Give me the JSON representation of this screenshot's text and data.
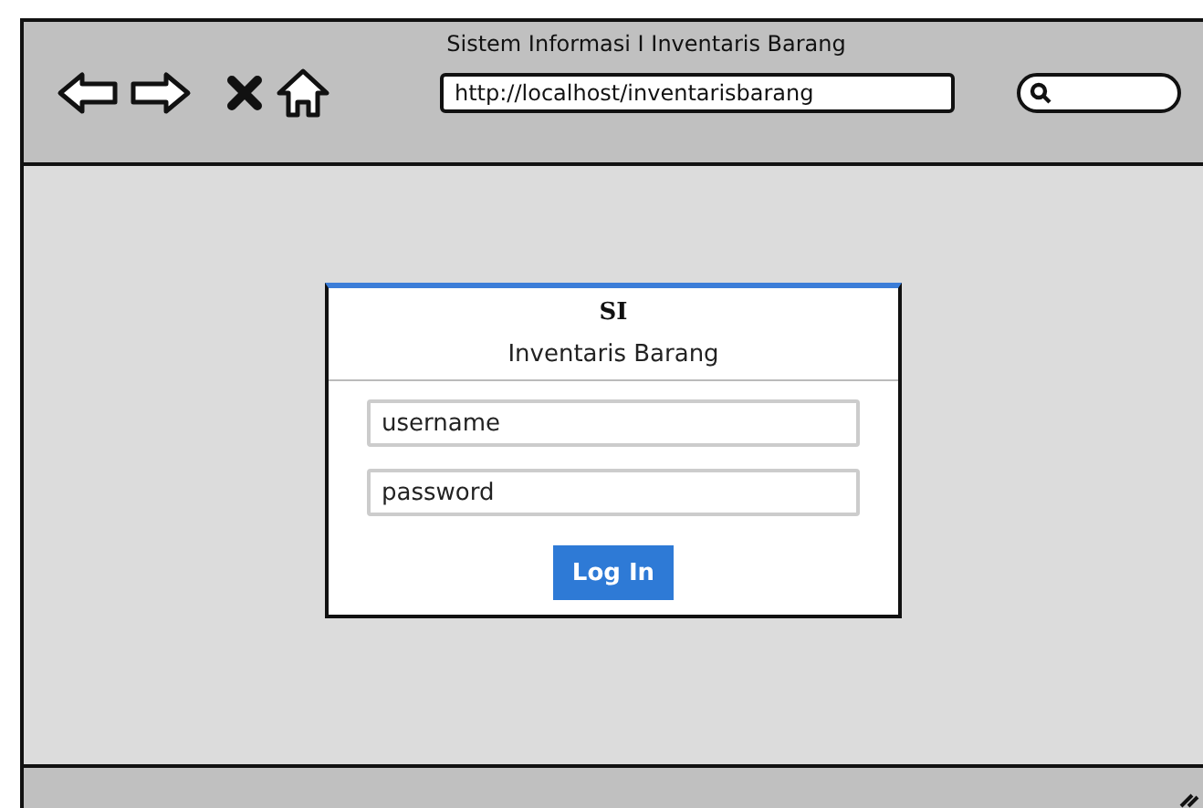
{
  "window": {
    "title": "Sistem Informasi I Inventaris Barang",
    "url": "http://localhost/inventarisbarang"
  },
  "login": {
    "title": "SI",
    "subtitle": "Inventaris Barang",
    "fields": [
      {
        "placeholder": "username"
      },
      {
        "placeholder": "password"
      }
    ],
    "button": "Log In"
  }
}
